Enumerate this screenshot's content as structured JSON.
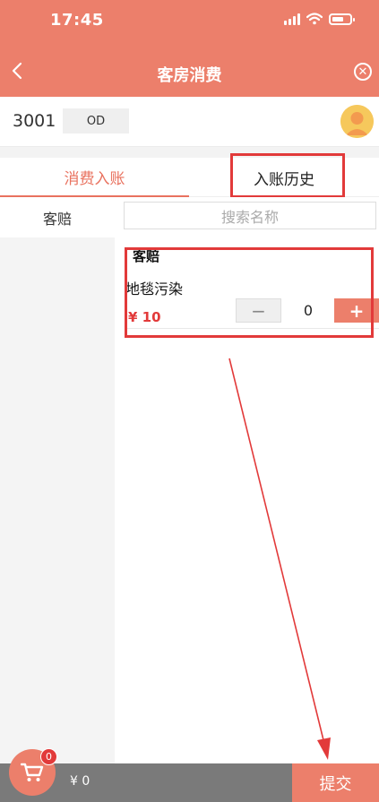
{
  "status_bar": {
    "time": "17:45"
  },
  "header": {
    "title": "客房消费"
  },
  "room": {
    "number": "3001",
    "status": "OD"
  },
  "tabs": [
    {
      "label": "消费入账",
      "active": true
    },
    {
      "label": "入账历史",
      "active": false
    }
  ],
  "sidebar": {
    "items": [
      {
        "label": "客赔"
      }
    ]
  },
  "search": {
    "placeholder": "搜索名称"
  },
  "category": {
    "title": "客赔"
  },
  "items": [
    {
      "name": "地毯污染",
      "price": "¥ 10",
      "quantity": "0",
      "minus_label": "−",
      "plus_label": "+"
    }
  ],
  "cart": {
    "badge": "0",
    "total": "¥ 0"
  },
  "footer": {
    "submit_label": "提交"
  },
  "colors": {
    "accent": "#ec7f6b",
    "highlight": "#e23a3a"
  },
  "icons": [
    "back-arrow-icon",
    "close-circle-icon",
    "signal-icon",
    "wifi-icon",
    "battery-icon",
    "user-avatar-icon",
    "cart-icon"
  ]
}
